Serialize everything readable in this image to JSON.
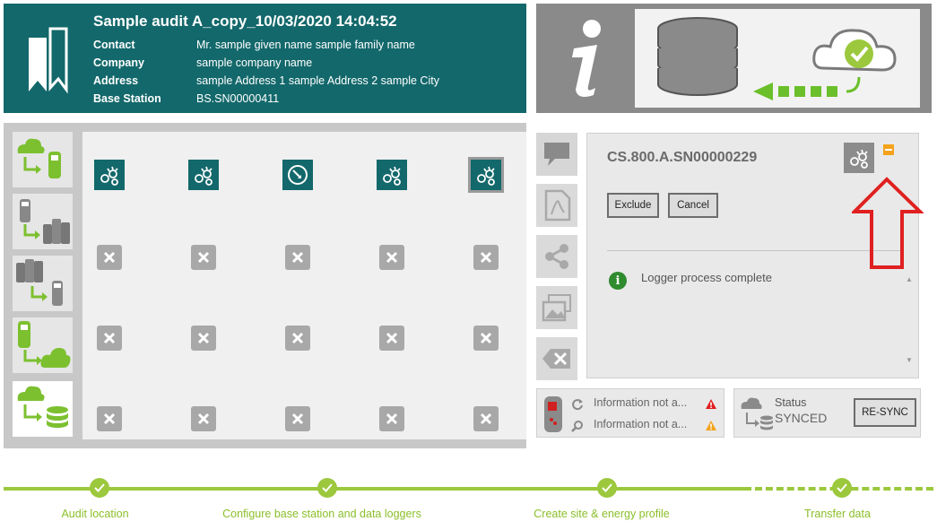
{
  "header": {
    "title": "Sample audit A_copy_10/03/2020 14:04:52",
    "fields": [
      {
        "label": "Contact",
        "value": "Mr. sample given name sample family name"
      },
      {
        "label": "Company",
        "value": "sample company name"
      },
      {
        "label": "Address",
        "value": "sample Address 1 sample Address 2 sample City"
      },
      {
        "label": "Base Station",
        "value": "BS.SN00000411"
      }
    ]
  },
  "detail": {
    "serial": "CS.800.A.SN00000229",
    "exclude_label": "Exclude",
    "cancel_label": "Cancel",
    "message": "Logger process complete"
  },
  "logger_status": {
    "line1": "Information not a...",
    "line2": "Information not a..."
  },
  "sync_status": {
    "label": "Status",
    "value": "SYNCED",
    "button": "RE-SYNC"
  },
  "progress": {
    "steps": [
      {
        "label": "Audit location"
      },
      {
        "label": "Configure base station and data loggers"
      },
      {
        "label": "Create site & energy profile"
      },
      {
        "label": "Transfer data"
      }
    ]
  },
  "colors": {
    "teal": "#13686b",
    "green": "#9bc83c",
    "orange": "#f4a21c",
    "red": "#e02020"
  }
}
